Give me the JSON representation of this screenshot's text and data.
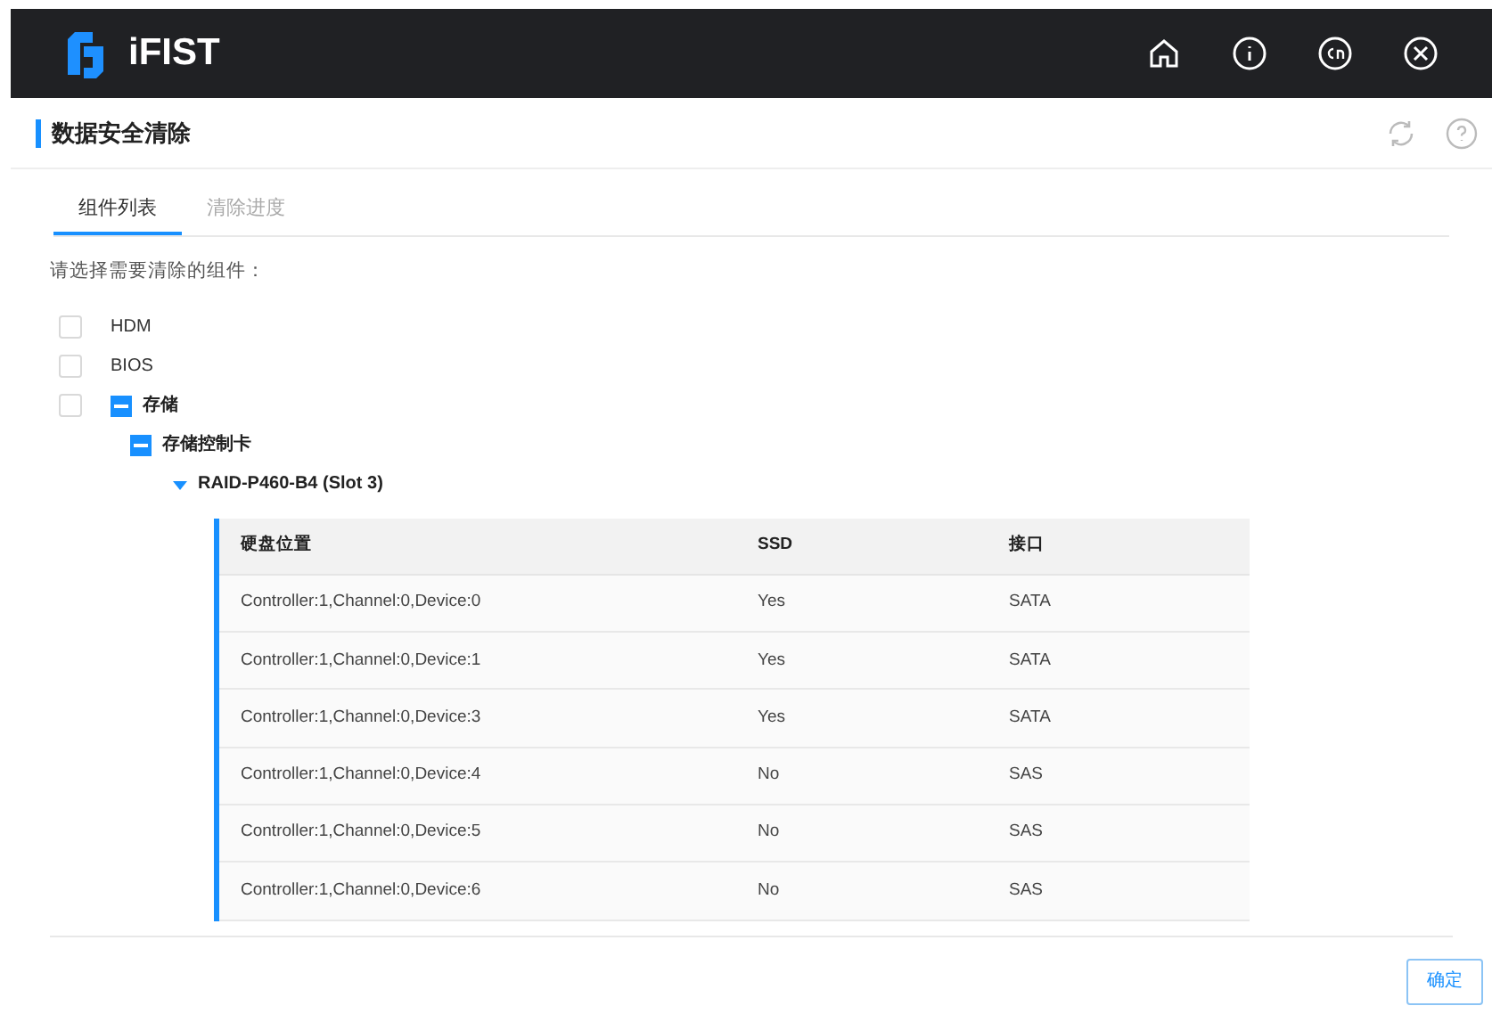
{
  "app": {
    "name": "iFIST"
  },
  "page": {
    "title": "数据安全清除"
  },
  "tabs": [
    {
      "label": "组件列表",
      "selected": true
    },
    {
      "label": "清除进度",
      "selected": false
    }
  ],
  "prompt": "请选择需要清除的组件：",
  "tree": [
    {
      "label": "HDM",
      "checked": false
    },
    {
      "label": "BIOS",
      "checked": false
    },
    {
      "label": "存储",
      "checked": false,
      "expanded": true,
      "children": [
        {
          "label": "存储控制卡",
          "expanded": true,
          "children": [
            {
              "label": "RAID-P460-B4 (Slot 3)",
              "expanded": true
            }
          ]
        }
      ]
    }
  ],
  "table": {
    "columns": [
      "硬盘位置",
      "SSD",
      "接口"
    ],
    "rows": [
      [
        "Controller:1,Channel:0,Device:0",
        "Yes",
        "SATA"
      ],
      [
        "Controller:1,Channel:0,Device:1",
        "Yes",
        "SATA"
      ],
      [
        "Controller:1,Channel:0,Device:3",
        "Yes",
        "SATA"
      ],
      [
        "Controller:1,Channel:0,Device:4",
        "No",
        "SAS"
      ],
      [
        "Controller:1,Channel:0,Device:5",
        "No",
        "SAS"
      ],
      [
        "Controller:1,Channel:0,Device:6",
        "No",
        "SAS"
      ]
    ]
  },
  "confirm_button": "确定"
}
